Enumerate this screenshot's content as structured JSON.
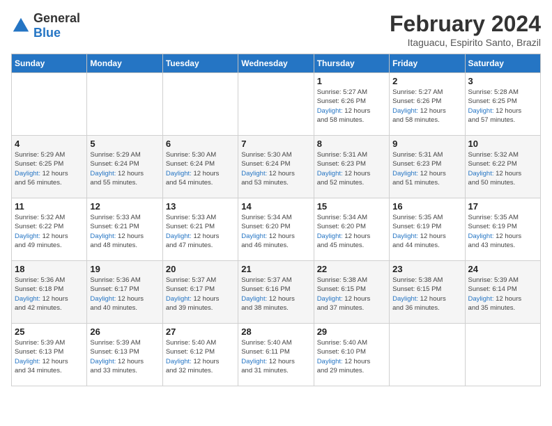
{
  "header": {
    "logo_general": "General",
    "logo_blue": "Blue",
    "title": "February 2024",
    "location": "Itaguacu, Espirito Santo, Brazil"
  },
  "days_of_week": [
    "Sunday",
    "Monday",
    "Tuesday",
    "Wednesday",
    "Thursday",
    "Friday",
    "Saturday"
  ],
  "weeks": [
    [
      {
        "day": "",
        "info": ""
      },
      {
        "day": "",
        "info": ""
      },
      {
        "day": "",
        "info": ""
      },
      {
        "day": "",
        "info": ""
      },
      {
        "day": "1",
        "info": "Sunrise: 5:27 AM\nSunset: 6:26 PM\nDaylight: 12 hours\nand 58 minutes."
      },
      {
        "day": "2",
        "info": "Sunrise: 5:27 AM\nSunset: 6:26 PM\nDaylight: 12 hours\nand 58 minutes."
      },
      {
        "day": "3",
        "info": "Sunrise: 5:28 AM\nSunset: 6:25 PM\nDaylight: 12 hours\nand 57 minutes."
      }
    ],
    [
      {
        "day": "4",
        "info": "Sunrise: 5:29 AM\nSunset: 6:25 PM\nDaylight: 12 hours\nand 56 minutes."
      },
      {
        "day": "5",
        "info": "Sunrise: 5:29 AM\nSunset: 6:24 PM\nDaylight: 12 hours\nand 55 minutes."
      },
      {
        "day": "6",
        "info": "Sunrise: 5:30 AM\nSunset: 6:24 PM\nDaylight: 12 hours\nand 54 minutes."
      },
      {
        "day": "7",
        "info": "Sunrise: 5:30 AM\nSunset: 6:24 PM\nDaylight: 12 hours\nand 53 minutes."
      },
      {
        "day": "8",
        "info": "Sunrise: 5:31 AM\nSunset: 6:23 PM\nDaylight: 12 hours\nand 52 minutes."
      },
      {
        "day": "9",
        "info": "Sunrise: 5:31 AM\nSunset: 6:23 PM\nDaylight: 12 hours\nand 51 minutes."
      },
      {
        "day": "10",
        "info": "Sunrise: 5:32 AM\nSunset: 6:22 PM\nDaylight: 12 hours\nand 50 minutes."
      }
    ],
    [
      {
        "day": "11",
        "info": "Sunrise: 5:32 AM\nSunset: 6:22 PM\nDaylight: 12 hours\nand 49 minutes."
      },
      {
        "day": "12",
        "info": "Sunrise: 5:33 AM\nSunset: 6:21 PM\nDaylight: 12 hours\nand 48 minutes."
      },
      {
        "day": "13",
        "info": "Sunrise: 5:33 AM\nSunset: 6:21 PM\nDaylight: 12 hours\nand 47 minutes."
      },
      {
        "day": "14",
        "info": "Sunrise: 5:34 AM\nSunset: 6:20 PM\nDaylight: 12 hours\nand 46 minutes."
      },
      {
        "day": "15",
        "info": "Sunrise: 5:34 AM\nSunset: 6:20 PM\nDaylight: 12 hours\nand 45 minutes."
      },
      {
        "day": "16",
        "info": "Sunrise: 5:35 AM\nSunset: 6:19 PM\nDaylight: 12 hours\nand 44 minutes."
      },
      {
        "day": "17",
        "info": "Sunrise: 5:35 AM\nSunset: 6:19 PM\nDaylight: 12 hours\nand 43 minutes."
      }
    ],
    [
      {
        "day": "18",
        "info": "Sunrise: 5:36 AM\nSunset: 6:18 PM\nDaylight: 12 hours\nand 42 minutes."
      },
      {
        "day": "19",
        "info": "Sunrise: 5:36 AM\nSunset: 6:17 PM\nDaylight: 12 hours\nand 40 minutes."
      },
      {
        "day": "20",
        "info": "Sunrise: 5:37 AM\nSunset: 6:17 PM\nDaylight: 12 hours\nand 39 minutes."
      },
      {
        "day": "21",
        "info": "Sunrise: 5:37 AM\nSunset: 6:16 PM\nDaylight: 12 hours\nand 38 minutes."
      },
      {
        "day": "22",
        "info": "Sunrise: 5:38 AM\nSunset: 6:15 PM\nDaylight: 12 hours\nand 37 minutes."
      },
      {
        "day": "23",
        "info": "Sunrise: 5:38 AM\nSunset: 6:15 PM\nDaylight: 12 hours\nand 36 minutes."
      },
      {
        "day": "24",
        "info": "Sunrise: 5:39 AM\nSunset: 6:14 PM\nDaylight: 12 hours\nand 35 minutes."
      }
    ],
    [
      {
        "day": "25",
        "info": "Sunrise: 5:39 AM\nSunset: 6:13 PM\nDaylight: 12 hours\nand 34 minutes."
      },
      {
        "day": "26",
        "info": "Sunrise: 5:39 AM\nSunset: 6:13 PM\nDaylight: 12 hours\nand 33 minutes."
      },
      {
        "day": "27",
        "info": "Sunrise: 5:40 AM\nSunset: 6:12 PM\nDaylight: 12 hours\nand 32 minutes."
      },
      {
        "day": "28",
        "info": "Sunrise: 5:40 AM\nSunset: 6:11 PM\nDaylight: 12 hours\nand 31 minutes."
      },
      {
        "day": "29",
        "info": "Sunrise: 5:40 AM\nSunset: 6:10 PM\nDaylight: 12 hours\nand 29 minutes."
      },
      {
        "day": "",
        "info": ""
      },
      {
        "day": "",
        "info": ""
      }
    ]
  ]
}
